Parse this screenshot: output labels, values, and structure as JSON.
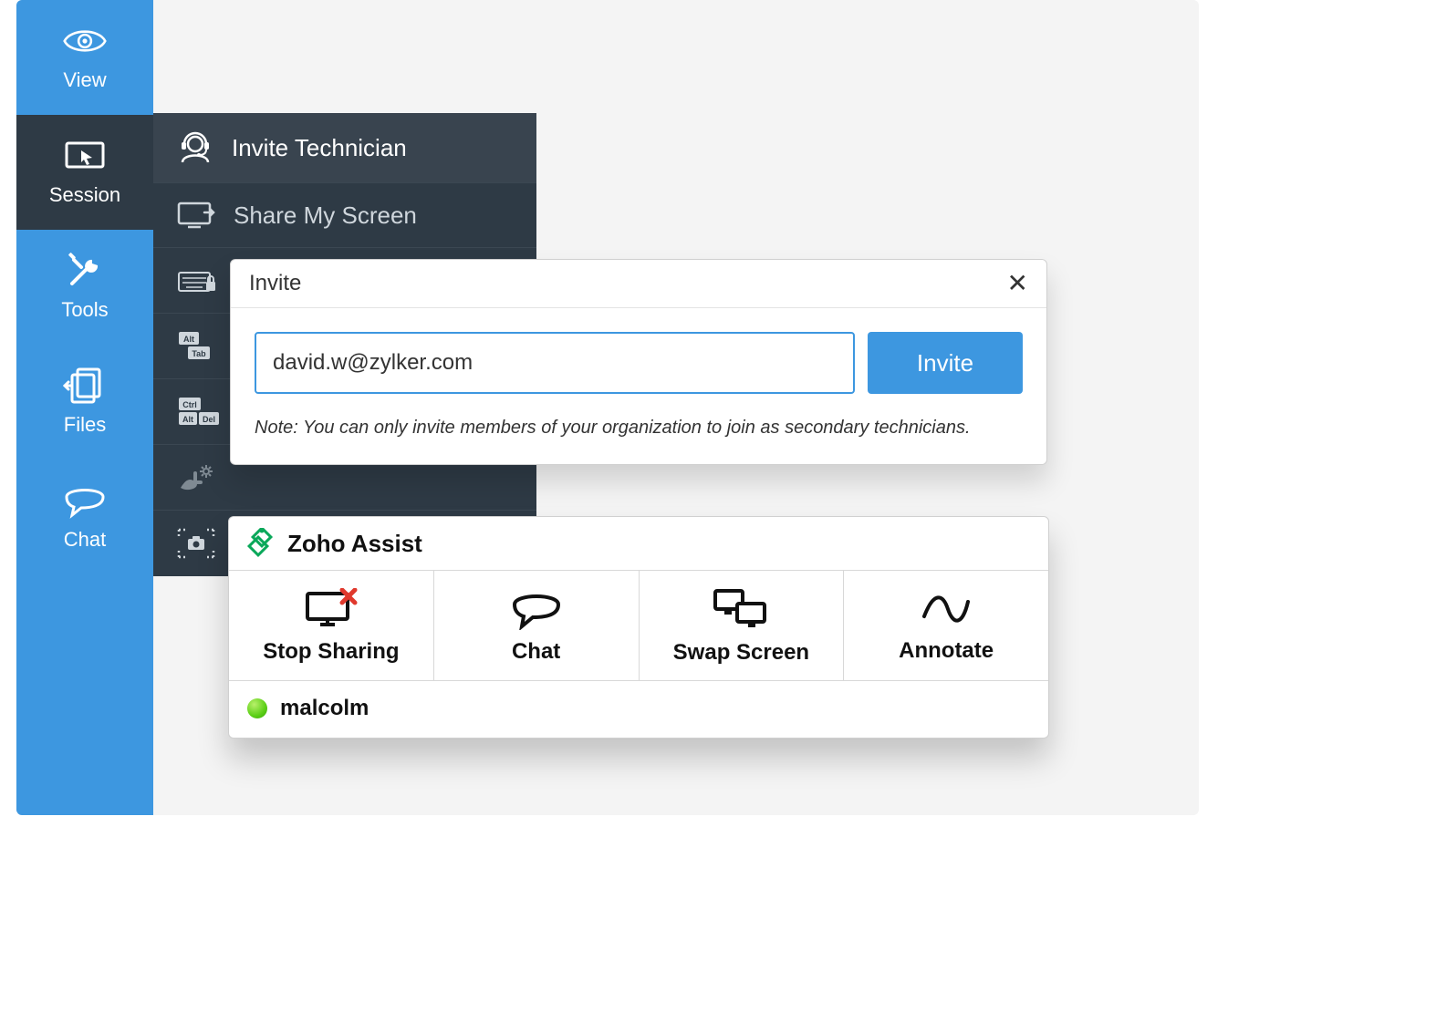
{
  "sidebar": {
    "items": [
      {
        "label": "View"
      },
      {
        "label": "Session"
      },
      {
        "label": "Tools"
      },
      {
        "label": "Files"
      },
      {
        "label": "Chat"
      }
    ]
  },
  "submenu": {
    "invite_label": "Invite Technician",
    "share_label": "Share My Screen"
  },
  "modal": {
    "title": "Invite",
    "email_value": "david.w@zylker.com",
    "invite_button": "Invite",
    "note": "Note: You can only invite members of your organization to join as secondary technicians."
  },
  "assist": {
    "brand": "Zoho Assist",
    "actions": [
      {
        "label": "Stop Sharing"
      },
      {
        "label": "Chat"
      },
      {
        "label": "Swap Screen"
      },
      {
        "label": "Annotate"
      }
    ],
    "presence_name": "malcolm"
  }
}
